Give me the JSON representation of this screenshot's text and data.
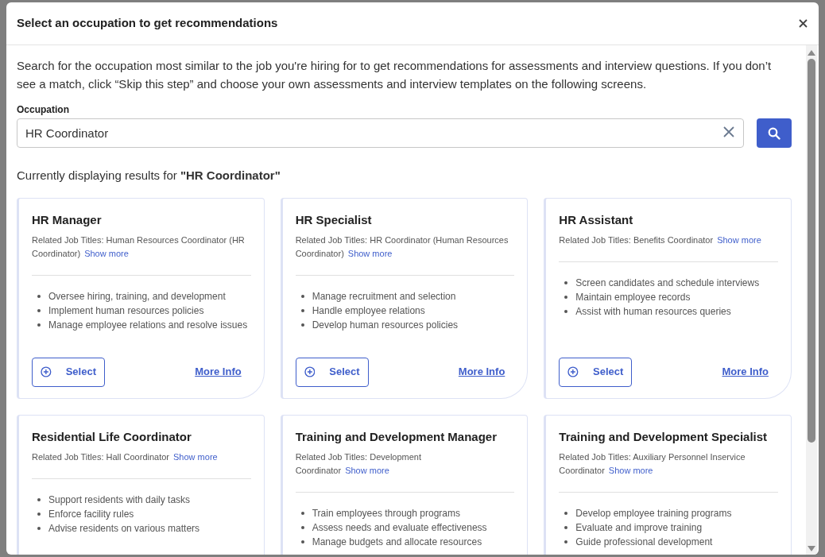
{
  "dialog": {
    "title": "Select an occupation to get recommendations"
  },
  "intro": "Search for the occupation most similar to the job you're hiring for to get recommendations for assessments and interview questions. If you don’t see a match, click “Skip this step” and choose your own assessments and interview templates on the following screens.",
  "search": {
    "label": "Occupation",
    "value": "HR Coordinator"
  },
  "results_heading": "Currently displaying results for **\"HR Coordinator\"**",
  "cards": [
    {
      "title": "HR Manager",
      "related": "Related Job Titles: Human Resources Coordinator (HR Coordinator)",
      "show_more": "Show more",
      "bullets": [
        "Oversee hiring, training, and development",
        "Implement human resources policies",
        "Manage employee relations and resolve issues"
      ],
      "select": "Select",
      "more_info": "More Info"
    },
    {
      "title": "HR Specialist",
      "related": "Related Job Titles: HR Coordinator (Human Resources Coordinator)",
      "show_more": "Show more",
      "bullets": [
        "Manage recruitment and selection",
        "Handle employee relations",
        "Develop human resources policies"
      ],
      "select": "Select",
      "more_info": "More Info"
    },
    {
      "title": "HR Assistant",
      "related": "Related Job Titles: Benefits Coordinator",
      "show_more": "Show more",
      "bullets": [
        "Screen candidates and schedule interviews",
        "Maintain employee records",
        "Assist with human resources queries"
      ],
      "select": "Select",
      "more_info": "More Info"
    },
    {
      "title": "Residential Life Coordinator",
      "related": "Related Job Titles: Hall Coordinator",
      "show_more": "Show more",
      "bullets": [
        "Support residents with daily tasks",
        "Enforce facility rules",
        "Advise residents on various matters"
      ]
    },
    {
      "title": "Training and Development Manager",
      "related": "Related Job Titles: Development Coordinator",
      "show_more": "Show more",
      "bullets": [
        "Train employees through programs",
        "Assess needs and evaluate effectiveness",
        "Manage budgets and allocate resources"
      ]
    },
    {
      "title": "Training and Development Specialist",
      "related": "Related Job Titles: Auxiliary Personnel Inservice Coordinator",
      "show_more": "Show more",
      "bullets": [
        "Develop employee training programs",
        "Evaluate and improve training",
        "Guide professional development"
      ]
    }
  ]
}
